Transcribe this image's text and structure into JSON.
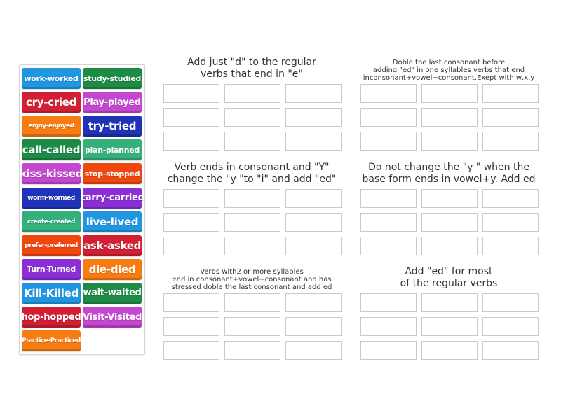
{
  "tiles": [
    {
      "label": "work-worked",
      "color": "#2196e0",
      "size": "s"
    },
    {
      "label": "study-studied",
      "color": "#1d8a45",
      "size": "s"
    },
    {
      "label": "cry-cried",
      "color": "#d21f34",
      "size": "l"
    },
    {
      "label": "Play-played",
      "color": "#c447d0",
      "size": "m"
    },
    {
      "label": "enjoy-enjoyed",
      "color": "#f77d12",
      "size": "xs"
    },
    {
      "label": "try-tried",
      "color": "#1e33b8",
      "size": "l"
    },
    {
      "label": "call-called",
      "color": "#1d8a45",
      "size": "l"
    },
    {
      "label": "plan-planned",
      "color": "#35b07a",
      "size": "s"
    },
    {
      "label": "kiss-kissed",
      "color": "#c447d0",
      "size": "l"
    },
    {
      "label": "stop-stopped",
      "color": "#f0470f",
      "size": "s"
    },
    {
      "label": "worm-wormed",
      "color": "#1e33b8",
      "size": "xs"
    },
    {
      "label": "carry-carried",
      "color": "#8a2ed6",
      "size": "m"
    },
    {
      "label": "create-created",
      "color": "#35b07a",
      "size": "xs"
    },
    {
      "label": "live-lived",
      "color": "#2196e0",
      "size": "l"
    },
    {
      "label": "prefer-preferred",
      "color": "#f0470f",
      "size": "xs"
    },
    {
      "label": "ask-asked",
      "color": "#d21f34",
      "size": "l"
    },
    {
      "label": "Turn-Turned",
      "color": "#8a2ed6",
      "size": "s"
    },
    {
      "label": "die-died",
      "color": "#f77d12",
      "size": "l"
    },
    {
      "label": "Kill-Killed",
      "color": "#2196e0",
      "size": "l"
    },
    {
      "label": "wait-waited",
      "color": "#1d8a45",
      "size": "m"
    },
    {
      "label": "hop-hopped",
      "color": "#d21f34",
      "size": "m"
    },
    {
      "label": "Visit-Visited",
      "color": "#c447d0",
      "size": "m"
    },
    {
      "label": "Practice-Practiced",
      "color": "#f77d12",
      "size": "xs"
    }
  ],
  "groups": [
    {
      "lines": [
        "Add just \"d\" to the regular",
        "verbs that end in \"e\""
      ],
      "style": "big"
    },
    {
      "lines": [
        "Doble the last consonant before",
        "adding \"ed\" in one syllables verbs that end",
        "inconsonant+vowel+consonant.Exept with w,x,y"
      ],
      "style": "small"
    },
    {
      "lines": [
        "Verb ends in consonant and \"Y\"",
        "change the \"y \"to \"i\" and add \"ed\""
      ],
      "style": "big"
    },
    {
      "lines": [
        "Do not change the \"y \" when the",
        "base form ends in vowel+y. Add ed"
      ],
      "style": "big"
    },
    {
      "lines": [
        "Verbs with2 or more syllables",
        "end in consonant+vowel+consonant and has",
        "stressed doble the last consonant and add ed"
      ],
      "style": "small"
    },
    {
      "lines": [
        "Add \"ed\" for most",
        "of the regular verbs"
      ],
      "style": "big"
    }
  ]
}
